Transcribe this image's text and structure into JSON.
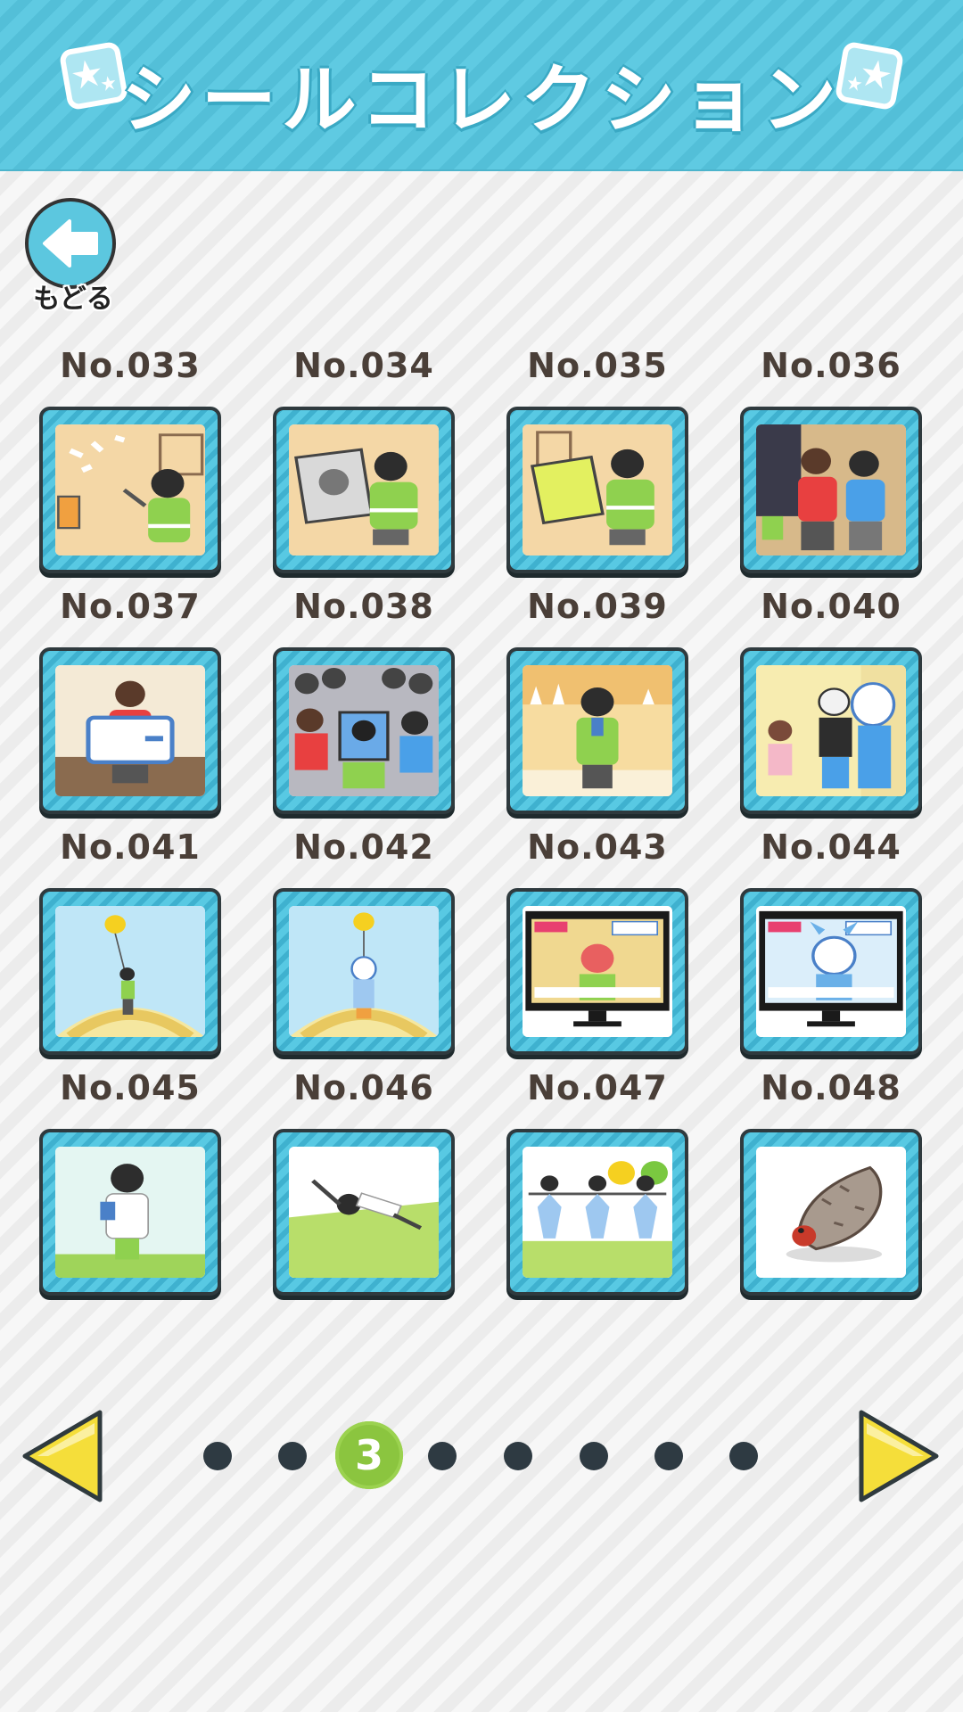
{
  "header": {
    "title": "シールコレクション",
    "icon_left": "star-sticker-icon",
    "icon_right": "star-sticker-icon",
    "color": "#5cc7df"
  },
  "back_button": {
    "label": "もどる",
    "icon": "arrow-left-icon"
  },
  "stickers": [
    {
      "label": "No.033",
      "scene": "sticker-image"
    },
    {
      "label": "No.034",
      "scene": "sticker-image"
    },
    {
      "label": "No.035",
      "scene": "sticker-image"
    },
    {
      "label": "No.036",
      "scene": "sticker-image"
    },
    {
      "label": "No.037",
      "scene": "sticker-image"
    },
    {
      "label": "No.038",
      "scene": "sticker-image"
    },
    {
      "label": "No.039",
      "scene": "sticker-image"
    },
    {
      "label": "No.040",
      "scene": "sticker-image"
    },
    {
      "label": "No.041",
      "scene": "sticker-image"
    },
    {
      "label": "No.042",
      "scene": "sticker-image"
    },
    {
      "label": "No.043",
      "scene": "sticker-image"
    },
    {
      "label": "No.044",
      "scene": "sticker-image"
    },
    {
      "label": "No.045",
      "scene": "sticker-image"
    },
    {
      "label": "No.046",
      "scene": "sticker-image"
    },
    {
      "label": "No.047",
      "scene": "sticker-image"
    },
    {
      "label": "No.048",
      "scene": "sticker-image"
    }
  ],
  "pager": {
    "current_page": "3",
    "total_pages": 8,
    "prev_icon": "triangle-left-icon",
    "next_icon": "triangle-right-icon",
    "arrow_color": "#f5de3a",
    "active_color": "#8bc53f"
  }
}
